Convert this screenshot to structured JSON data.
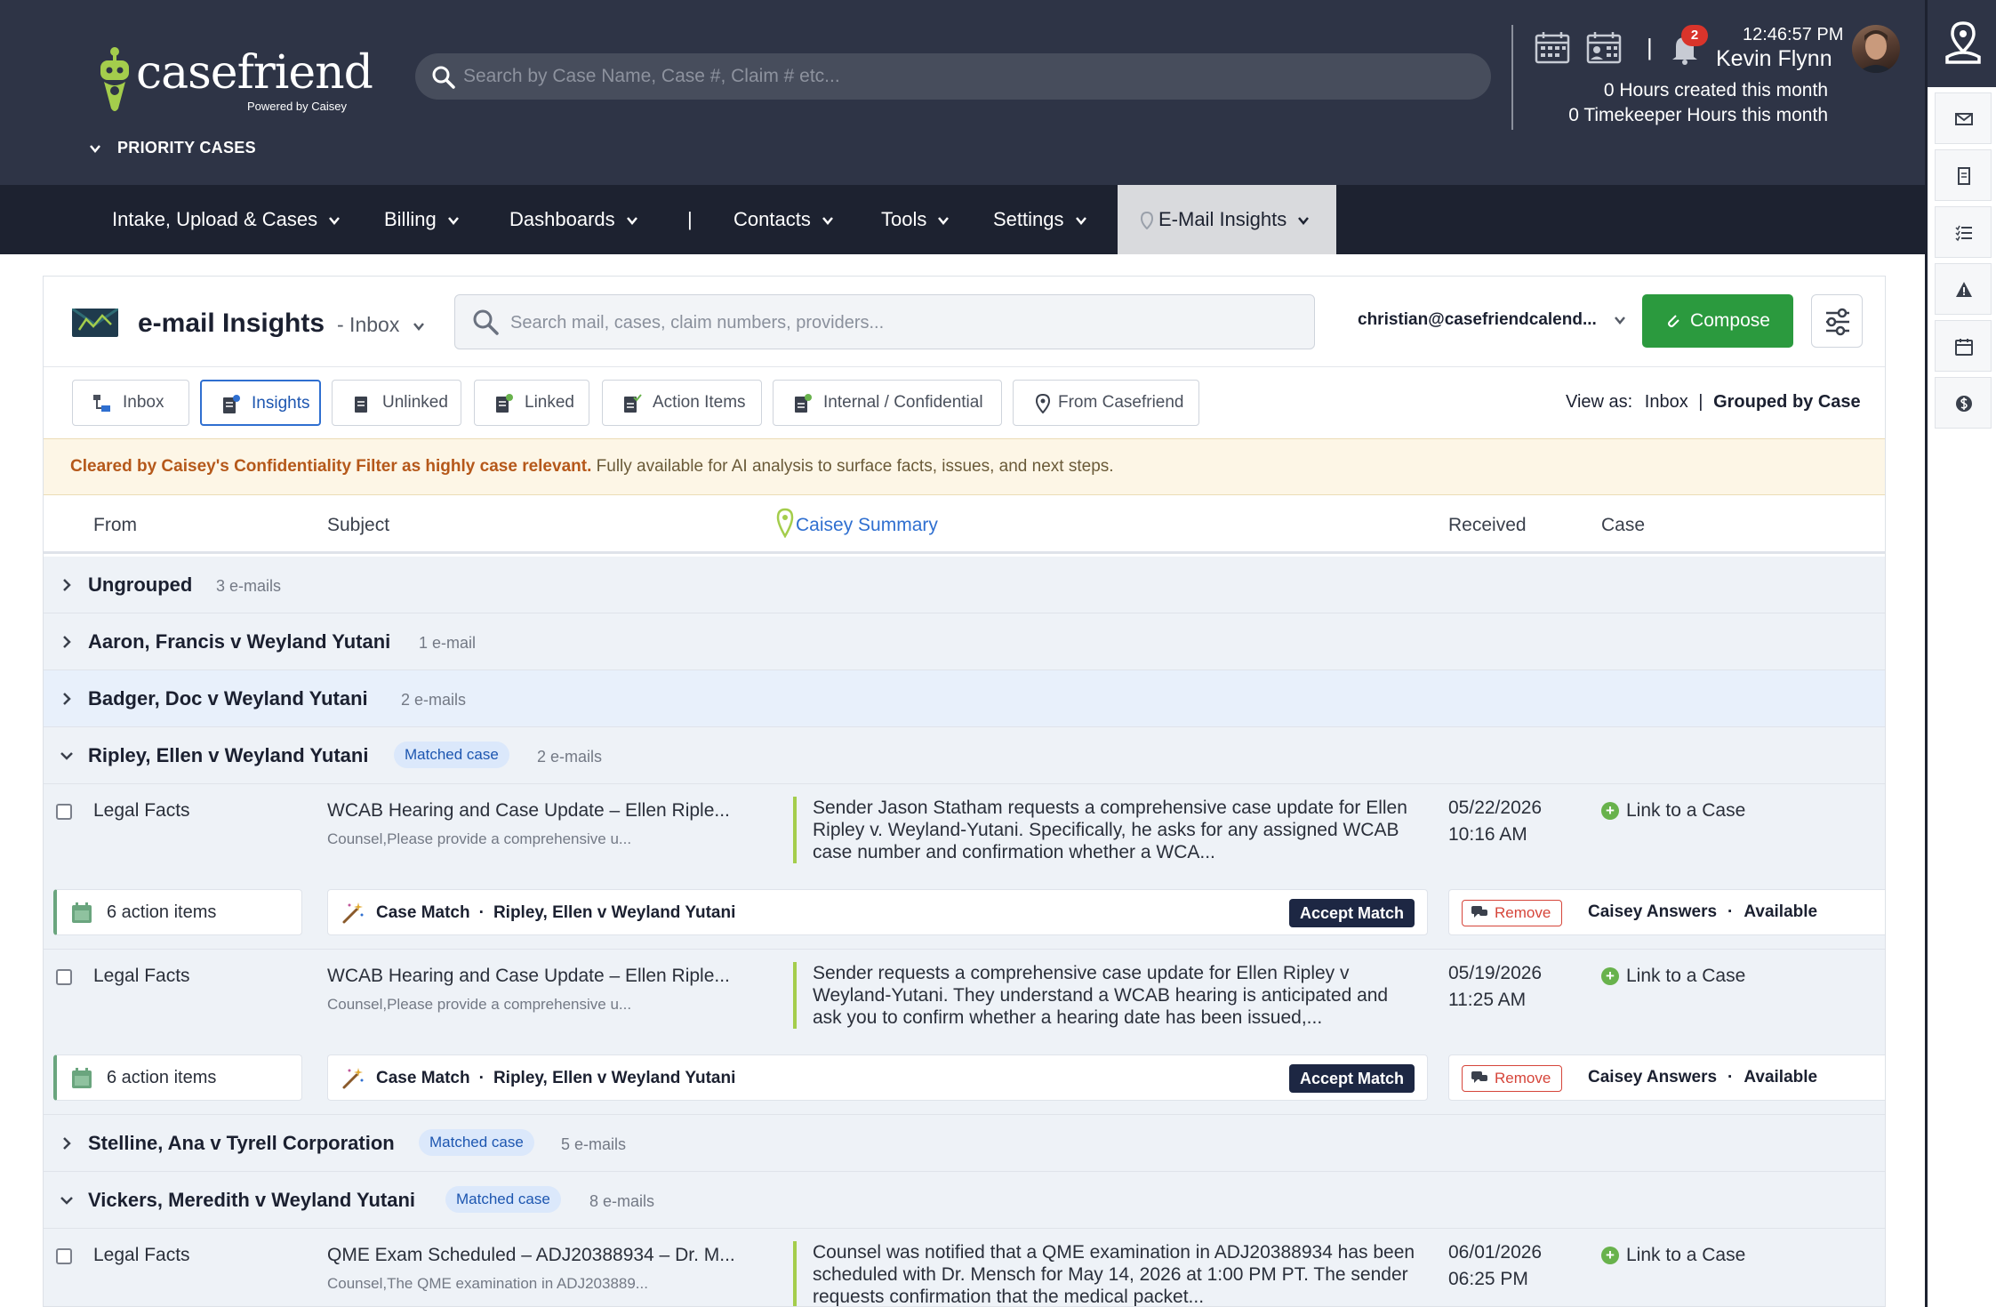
{
  "header": {
    "logo": {
      "name": "casefriend",
      "powered_by": "Powered by Caisey"
    },
    "search_placeholder": "Search by Case Name, Case #, Claim # etc...",
    "priority_label": "PRIORITY CASES",
    "notifications_count": "2",
    "time": "12:46:57 PM",
    "user_name": "Kevin Flynn",
    "hours_created": "0 Hours created this month",
    "timekeeper_hours": "0 Timekeeper Hours this month"
  },
  "nav": {
    "items": [
      {
        "label": "Intake, Upload & Cases"
      },
      {
        "label": "Billing"
      },
      {
        "label": "Dashboards"
      },
      {
        "label": "|"
      },
      {
        "label": "Contacts"
      },
      {
        "label": "Tools"
      },
      {
        "label": "Settings"
      },
      {
        "label": "E-Mail Insights",
        "active": true
      }
    ]
  },
  "insights": {
    "title": "e-mail Insights",
    "folder": "- Inbox",
    "search_placeholder": "Search mail, cases, claim numbers, providers...",
    "account": "christian@casefriendcalend...",
    "compose_label": "Compose",
    "tabs": [
      {
        "label": "Inbox"
      },
      {
        "label": "Insights",
        "active": true
      },
      {
        "label": "Unlinked"
      },
      {
        "label": "Linked"
      },
      {
        "label": "Action Items"
      },
      {
        "label": "Internal / Confidential"
      },
      {
        "label": "From Casefriend"
      }
    ],
    "view_as": {
      "label": "View as:",
      "inbox": "Inbox",
      "separator": "|",
      "grouped": "Grouped by Case"
    },
    "notice": {
      "highlight": "Cleared by Caisey's Confidentiality Filter as highly case relevant.",
      "text": "Fully available for AI analysis to surface facts, issues, and next steps."
    },
    "columns": {
      "from": "From",
      "subject": "Subject",
      "summary": "Caisey Summary",
      "received": "Received",
      "case": "Case"
    }
  },
  "groups": [
    {
      "name": "Ungrouped",
      "count": "3 e-mails",
      "expanded": false
    },
    {
      "name": "Aaron, Francis v Weyland Yutani",
      "count": "1 e-mail",
      "expanded": false
    },
    {
      "name": "Badger, Doc v Weyland Yutani",
      "count": "2 e-mails",
      "expanded": false
    },
    {
      "name": "Ripley, Ellen v Weyland Yutani",
      "badge": "Matched case",
      "count": "2 e-mails",
      "expanded": true
    },
    {
      "name": "Stelline, Ana v Tyrell Corporation",
      "badge": "Matched case",
      "count": "5 e-mails",
      "expanded": false
    },
    {
      "name": "Vickers, Meredith v Weyland Yutani",
      "badge": "Matched case",
      "count": "8 e-mails",
      "expanded": true
    }
  ],
  "emails": [
    {
      "from": "Legal Facts",
      "subject": "WCAB Hearing and Case Update – Ellen Riple...",
      "preview": "Counsel,Please provide a comprehensive u...",
      "summary": "Sender Jason Statham requests a comprehensive case update for Ellen Ripley v. Weyland-Yutani. Specifically, he asks for any assigned WCAB case number and confirmation whether a WCA...",
      "date": "05/22/2026",
      "time": "10:16 AM",
      "link_label": "Link to a Case",
      "action_items": "6 action items",
      "match_label": "Case Match",
      "match_sep": "·",
      "match_case": "Ripley, Ellen v Weyland Yutani",
      "accept_label": "Accept Match",
      "remove_label": "Remove",
      "answers_label": "Caisey Answers",
      "answers_sep": "·",
      "answers_status": "Available"
    },
    {
      "from": "Legal Facts",
      "subject": "WCAB Hearing and Case Update – Ellen Riple...",
      "preview": "Counsel,Please provide a comprehensive u...",
      "summary": "Sender requests a comprehensive case update for Ellen Ripley v Weyland-Yutani. They understand a WCAB hearing is anticipated and ask you to confirm whether a hearing date has been issued,...",
      "date": "05/19/2026",
      "time": "11:25 AM",
      "link_label": "Link to a Case",
      "action_items": "6 action items",
      "match_label": "Case Match",
      "match_sep": "·",
      "match_case": "Ripley, Ellen v Weyland Yutani",
      "accept_label": "Accept Match",
      "remove_label": "Remove",
      "answers_label": "Caisey Answers",
      "answers_sep": "·",
      "answers_status": "Available"
    },
    {
      "from": "Legal Facts",
      "subject": "QME Exam Scheduled – ADJ20388934 – Dr. M...",
      "preview": "Counsel,The QME examination in ADJ203889...",
      "summary": "Counsel was notified that a QME examination in ADJ20388934 has been scheduled with Dr. Mensch for May 14, 2026 at 1:00 PM PT. The sender requests confirmation that the medical packet...",
      "date": "06/01/2026",
      "time": "06:25 PM",
      "link_label": "Link to a Case"
    }
  ],
  "colors": {
    "header_bg": "#2e3446",
    "nav_bg": "#1d2230",
    "compose_green": "#2b9a3e",
    "accent_blue": "#2f6fd0",
    "remove_red": "#d6453a"
  }
}
